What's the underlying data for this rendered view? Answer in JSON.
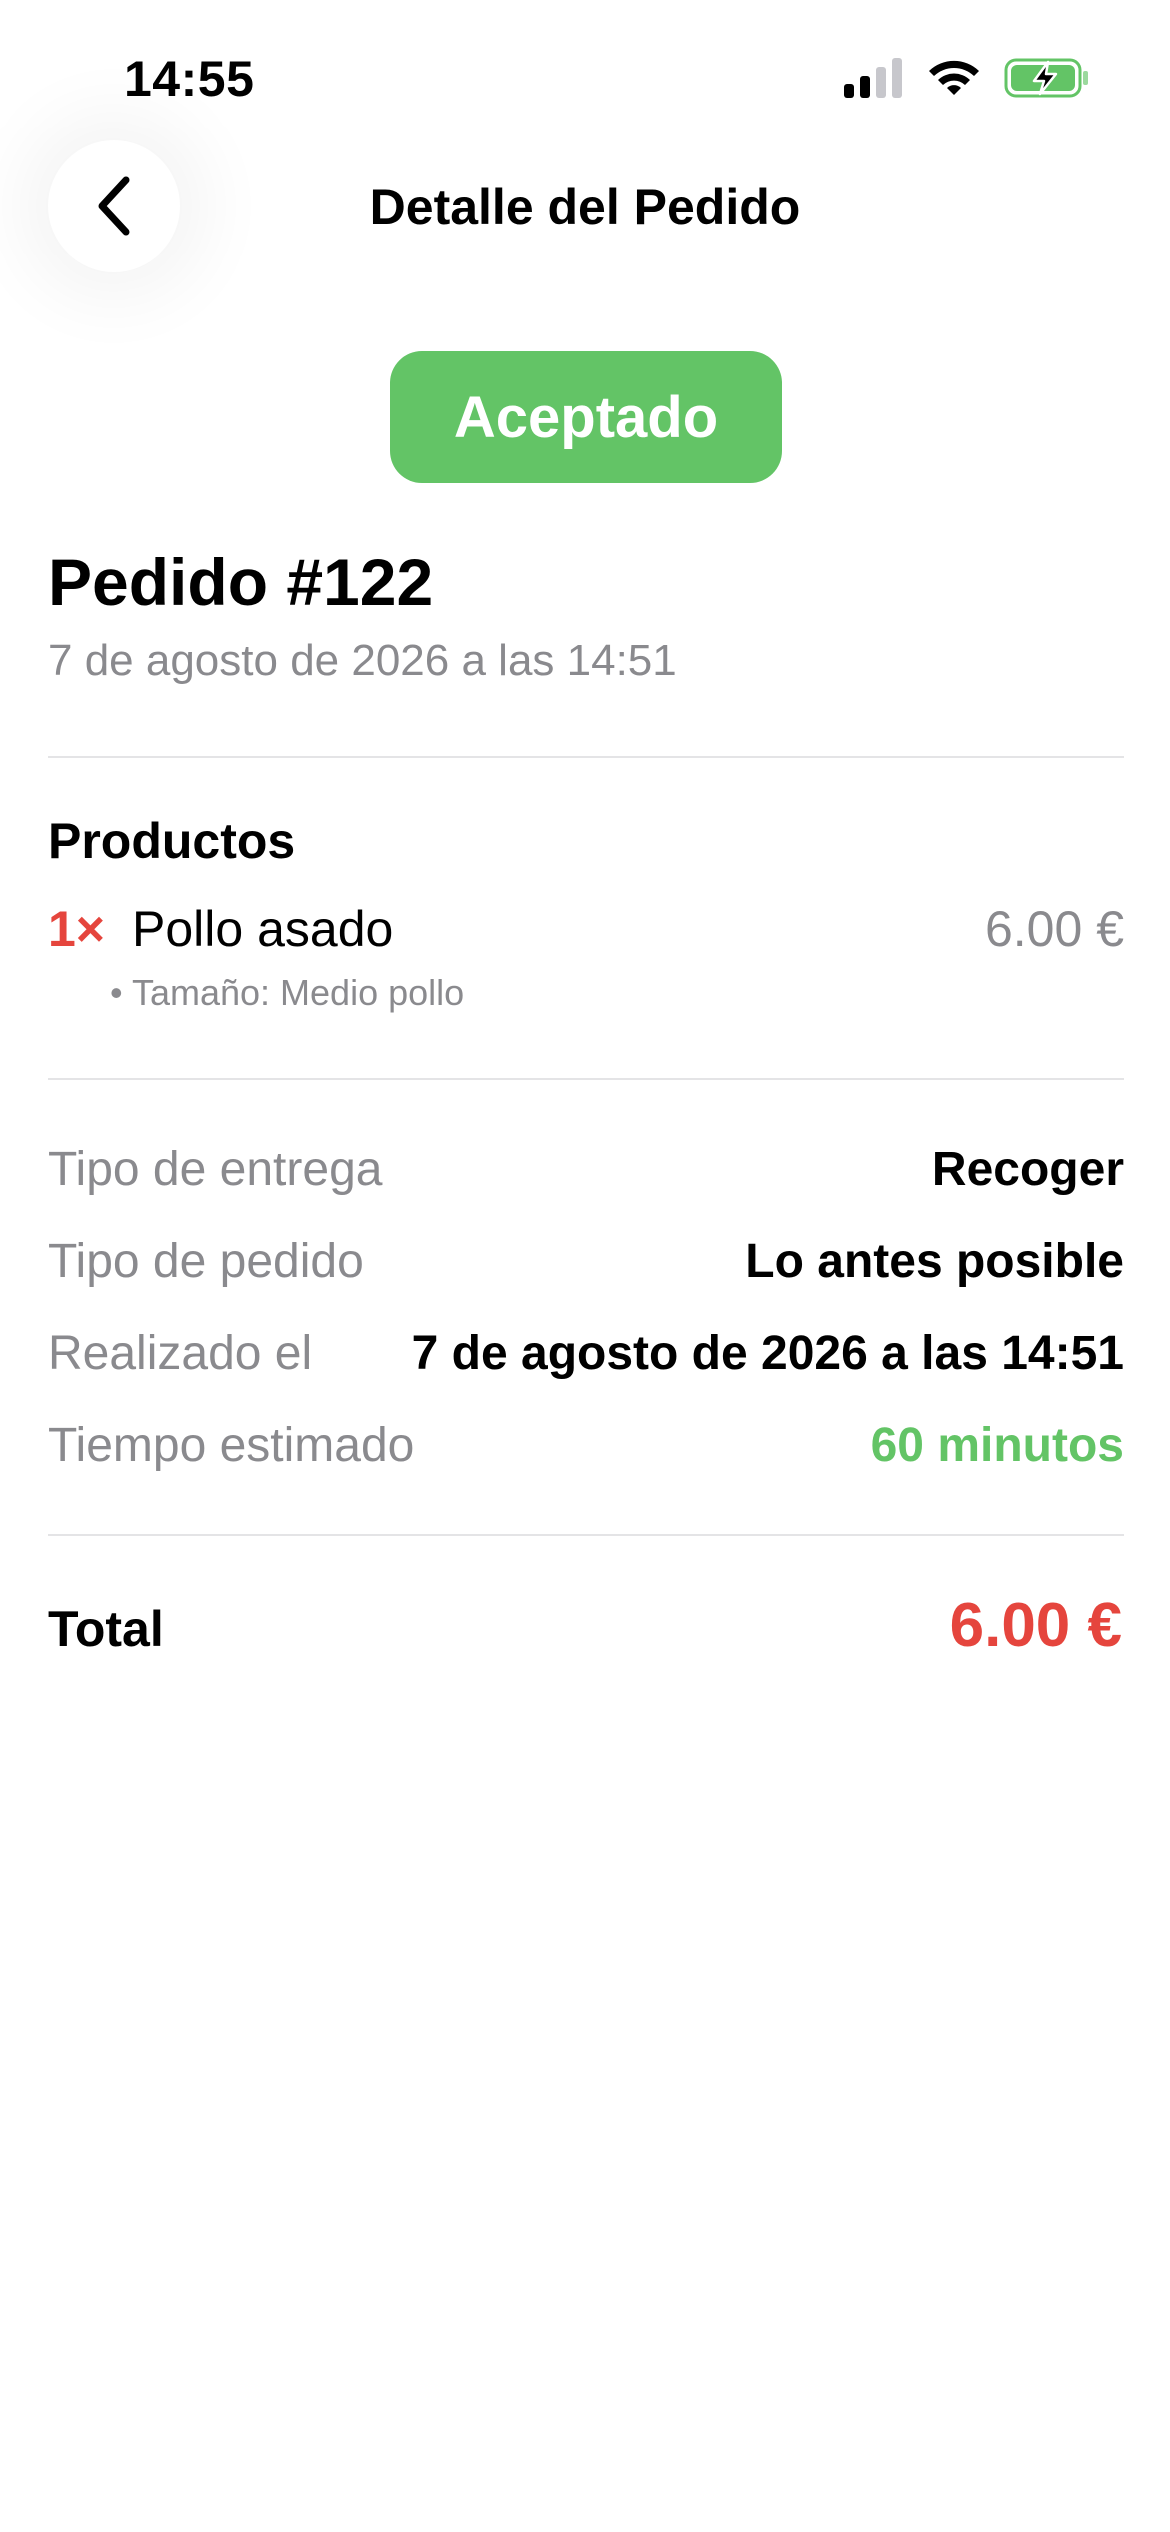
{
  "status_bar": {
    "time": "14:55",
    "icons": [
      "cellular-signal-icon",
      "wifi-icon",
      "battery-charging-icon"
    ]
  },
  "header": {
    "back_icon": "chevron-left-icon",
    "title": "Detalle del Pedido"
  },
  "order": {
    "status": "Aceptado",
    "number": "Pedido #122",
    "date": "7 de agosto de 2026 a las 14:51"
  },
  "products": {
    "title": "Productos",
    "items": [
      {
        "quantity": "1×",
        "name": "Pollo asado",
        "price": "6.00 €",
        "options": [
          "• Tamaño: Medio pollo"
        ]
      }
    ]
  },
  "details": [
    {
      "label": "Tipo de entrega",
      "value": "Recoger"
    },
    {
      "label": "Tipo de pedido",
      "value": "Lo antes posible"
    },
    {
      "label": "Realizado el",
      "value": "7 de agosto de 2026 a las 14:51"
    },
    {
      "label": "Tiempo estimado",
      "value": "60 minutos"
    }
  ],
  "total": {
    "label": "Total",
    "value": "6.00 €"
  },
  "colors": {
    "accent_green": "#63c466",
    "accent_red": "#e5453d",
    "secondary_text": "#8a8a8e",
    "divider": "#e4e4e6"
  }
}
